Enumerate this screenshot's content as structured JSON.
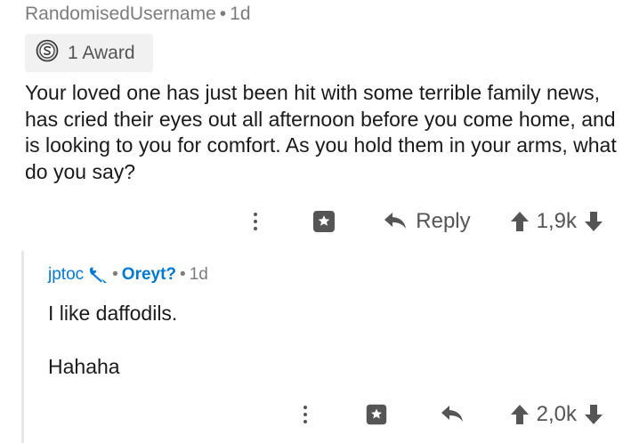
{
  "comment": {
    "username": "RandomisedUsername",
    "separator": "•",
    "time": "1d",
    "award_label": "1 Award",
    "body": "Your loved one has just been hit with some terrible family news, has cried their eyes out all afternoon before you come home, and is looking to you for comfort. As you hold them in your arms, what do you say?",
    "reply_label": "Reply",
    "vote_count": "1,9k"
  },
  "reply": {
    "username": "jptoc",
    "separator": "•",
    "flair": "Oreyt?",
    "time": "1d",
    "line1": "I like daffodils.",
    "line2": "Hahaha",
    "vote_count": "2,0k"
  },
  "colors": {
    "accent_blue": "#0079d3",
    "meta_grey": "#7c7c7c",
    "icon_grey": "#555555",
    "pill_bg": "#f1f1f1"
  },
  "icons": [
    "award-silver-icon",
    "more-options-icon",
    "give-award-icon",
    "reply-arrow-icon",
    "upvote-icon",
    "downvote-icon",
    "wrench-mod-icon"
  ]
}
